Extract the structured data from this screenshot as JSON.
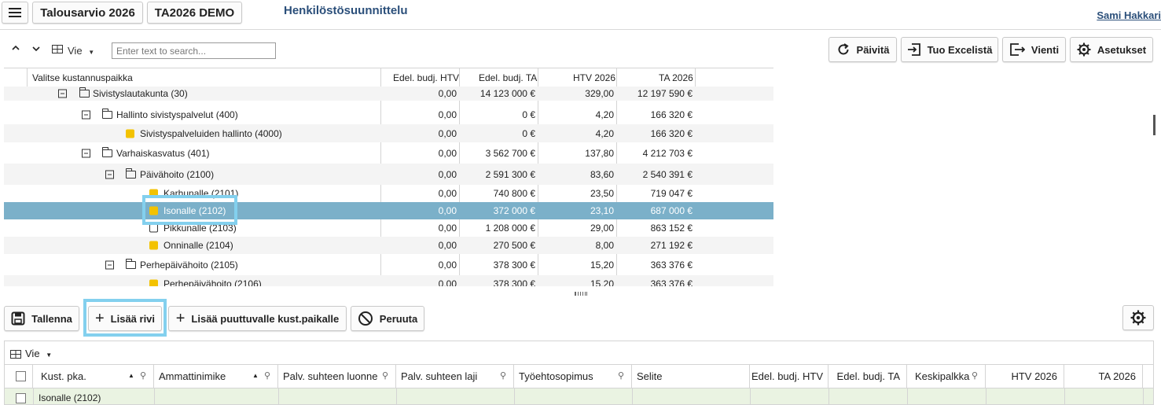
{
  "header": {
    "menu_icon": "hamburger-icon",
    "budget_button": "Talousarvio 2026",
    "demo_button": "TA2026 DEMO",
    "title": "Henkilöstösuunnittelu",
    "user": "Sami Hakkari"
  },
  "toolbar": {
    "export_label": "Vie",
    "search_placeholder": "Enter text to search...",
    "refresh": "Päivitä",
    "import_excel": "Tuo Excelistä",
    "export": "Vienti",
    "settings": "Asetukset"
  },
  "upper_grid": {
    "headers": [
      "Valitse kustannuspaikka",
      "Edel. budj. HTV",
      "Edel. budj. TA",
      "HTV 2026",
      "TA 2026"
    ],
    "rows": [
      {
        "name": "Sivistyslautakunta (30)",
        "htv_prev": "0,00",
        "ta_prev": "14 123 000 €",
        "htv": "329,00",
        "ta": "12 197 590 €"
      },
      {
        "name": "Hallinto sivistyspalvelut (400)",
        "htv_prev": "0,00",
        "ta_prev": "0 €",
        "htv": "4,20",
        "ta": "166 320 €"
      },
      {
        "name": "Sivistyspalveluiden hallinto (4000)",
        "htv_prev": "0,00",
        "ta_prev": "0 €",
        "htv": "4,20",
        "ta": "166 320 €"
      },
      {
        "name": "Varhaiskasvatus (401)",
        "htv_prev": "0,00",
        "ta_prev": "3 562 700 €",
        "htv": "137,80",
        "ta": "4 212 703 €"
      },
      {
        "name": "Päivähoito (2100)",
        "htv_prev": "0,00",
        "ta_prev": "2 591 300 €",
        "htv": "83,60",
        "ta": "2 540 391 €"
      },
      {
        "name": "Karhunalle (2101)",
        "htv_prev": "0,00",
        "ta_prev": "740 800 €",
        "htv": "23,50",
        "ta": "719 047 €"
      },
      {
        "name": "Isonalle (2102)",
        "htv_prev": "0,00",
        "ta_prev": "372 000 €",
        "htv": "23,10",
        "ta": "687 000 €"
      },
      {
        "name": "Pikkunalle (2103)",
        "htv_prev": "0,00",
        "ta_prev": "1 208 000 €",
        "htv": "29,00",
        "ta": "863 152 €"
      },
      {
        "name": "Onninalle (2104)",
        "htv_prev": "0,00",
        "ta_prev": "270 500 €",
        "htv": "8,00",
        "ta": "271 192 €"
      },
      {
        "name": "Perhepäivähoito (2105)",
        "htv_prev": "0,00",
        "ta_prev": "378 300 €",
        "htv": "15,20",
        "ta": "363 376 €"
      },
      {
        "name": "Perhepäivähoito (2106)",
        "htv_prev": "0,00",
        "ta_prev": "378 300 €",
        "htv": "15,20",
        "ta": "363 376 €"
      }
    ]
  },
  "actions": {
    "save": "Tallenna",
    "add_row": "Lisää rivi",
    "add_missing": "Lisää puuttuvalle kust.paikalle",
    "cancel": "Peruuta"
  },
  "lower_grid": {
    "export_label": "Vie",
    "headers": [
      "Kust. pka.",
      "Ammattinimike",
      "Palv. suhteen luonne",
      "Palv. suhteen laji",
      "Työehtosopimus",
      "Selite",
      "Edel. budj. HTV",
      "Edel. budj. TA",
      "Keskipalkka",
      "HTV 2026",
      "TA 2026"
    ],
    "first_row_name": "Isonalle (2102)"
  },
  "colors": {
    "selected_row": "#7bb0c9",
    "highlight_box": "#83d0ee",
    "leaf_icon": "#f3c200",
    "title": "#2b4f7a"
  }
}
